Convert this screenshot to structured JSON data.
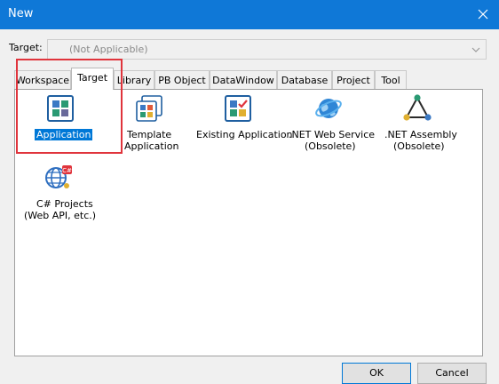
{
  "window": {
    "title": "New"
  },
  "target": {
    "label": "Target:",
    "value": "(Not Applicable)"
  },
  "tabs": [
    "Workspace",
    "Target",
    "Library",
    "PB Object",
    "DataWindow",
    "Database",
    "Project",
    "Tool"
  ],
  "active_tab": "Target",
  "items": [
    {
      "label_lines": [
        "Application"
      ],
      "icon": "application-icon",
      "selected": true
    },
    {
      "label_lines": [
        "Template",
        "Application"
      ],
      "icon": "template-application-icon",
      "selected": false
    },
    {
      "label_lines": [
        "Existing Application"
      ],
      "icon": "existing-application-icon",
      "selected": false
    },
    {
      "label_lines": [
        ".NET Web Service",
        "(Obsolete)"
      ],
      "icon": "net-web-service-icon",
      "selected": false
    },
    {
      "label_lines": [
        ".NET Assembly",
        "(Obsolete)"
      ],
      "icon": "net-assembly-icon",
      "selected": false
    },
    {
      "label_lines": [
        "C# Projects",
        "(Web API, etc.)"
      ],
      "icon": "csharp-projects-icon",
      "selected": false
    }
  ],
  "buttons": {
    "ok": "OK",
    "cancel": "Cancel"
  },
  "colors": {
    "titlebar": "#0f78d7",
    "selection": "#0078d7",
    "highlight_box": "#e0343c"
  }
}
